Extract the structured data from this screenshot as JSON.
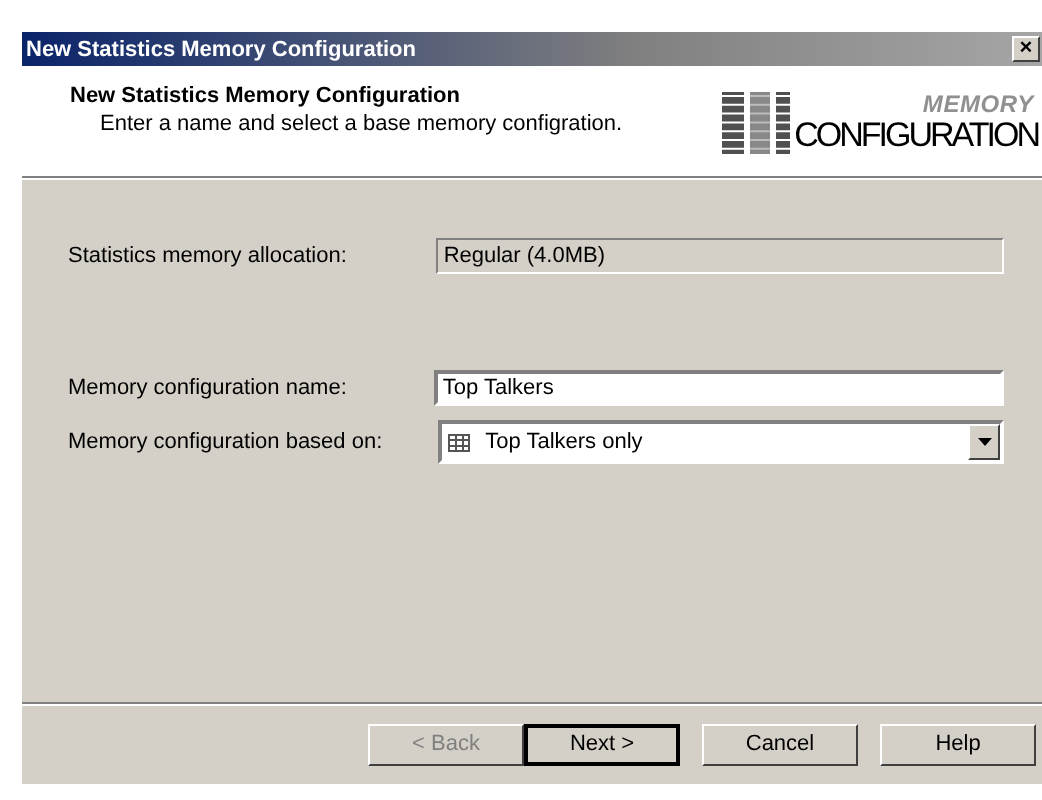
{
  "window": {
    "title": "New Statistics Memory Configuration",
    "close_glyph": "×"
  },
  "header": {
    "title": "New Statistics Memory Configuration",
    "subtitle": "Enter a name and select a base memory configration.",
    "logo_top": "MEMORY",
    "logo_bottom": "CONFIGURATION"
  },
  "fields": [
    {
      "kind": "readonly",
      "label": "Statistics memory allocation:",
      "value": "Regular (4.0MB)"
    },
    {
      "kind": "text",
      "label": "Memory configuration name:",
      "value": "Top Talkers"
    },
    {
      "kind": "combo",
      "label": "Memory configuration based on:",
      "value": "Top Talkers only"
    }
  ],
  "buttons": [
    {
      "label": "< Back",
      "disabled": true,
      "default": false
    },
    {
      "label": "Next >",
      "disabled": false,
      "default": true
    },
    {
      "label": "Cancel",
      "disabled": false,
      "default": false
    },
    {
      "label": "Help",
      "disabled": false,
      "default": false
    }
  ]
}
